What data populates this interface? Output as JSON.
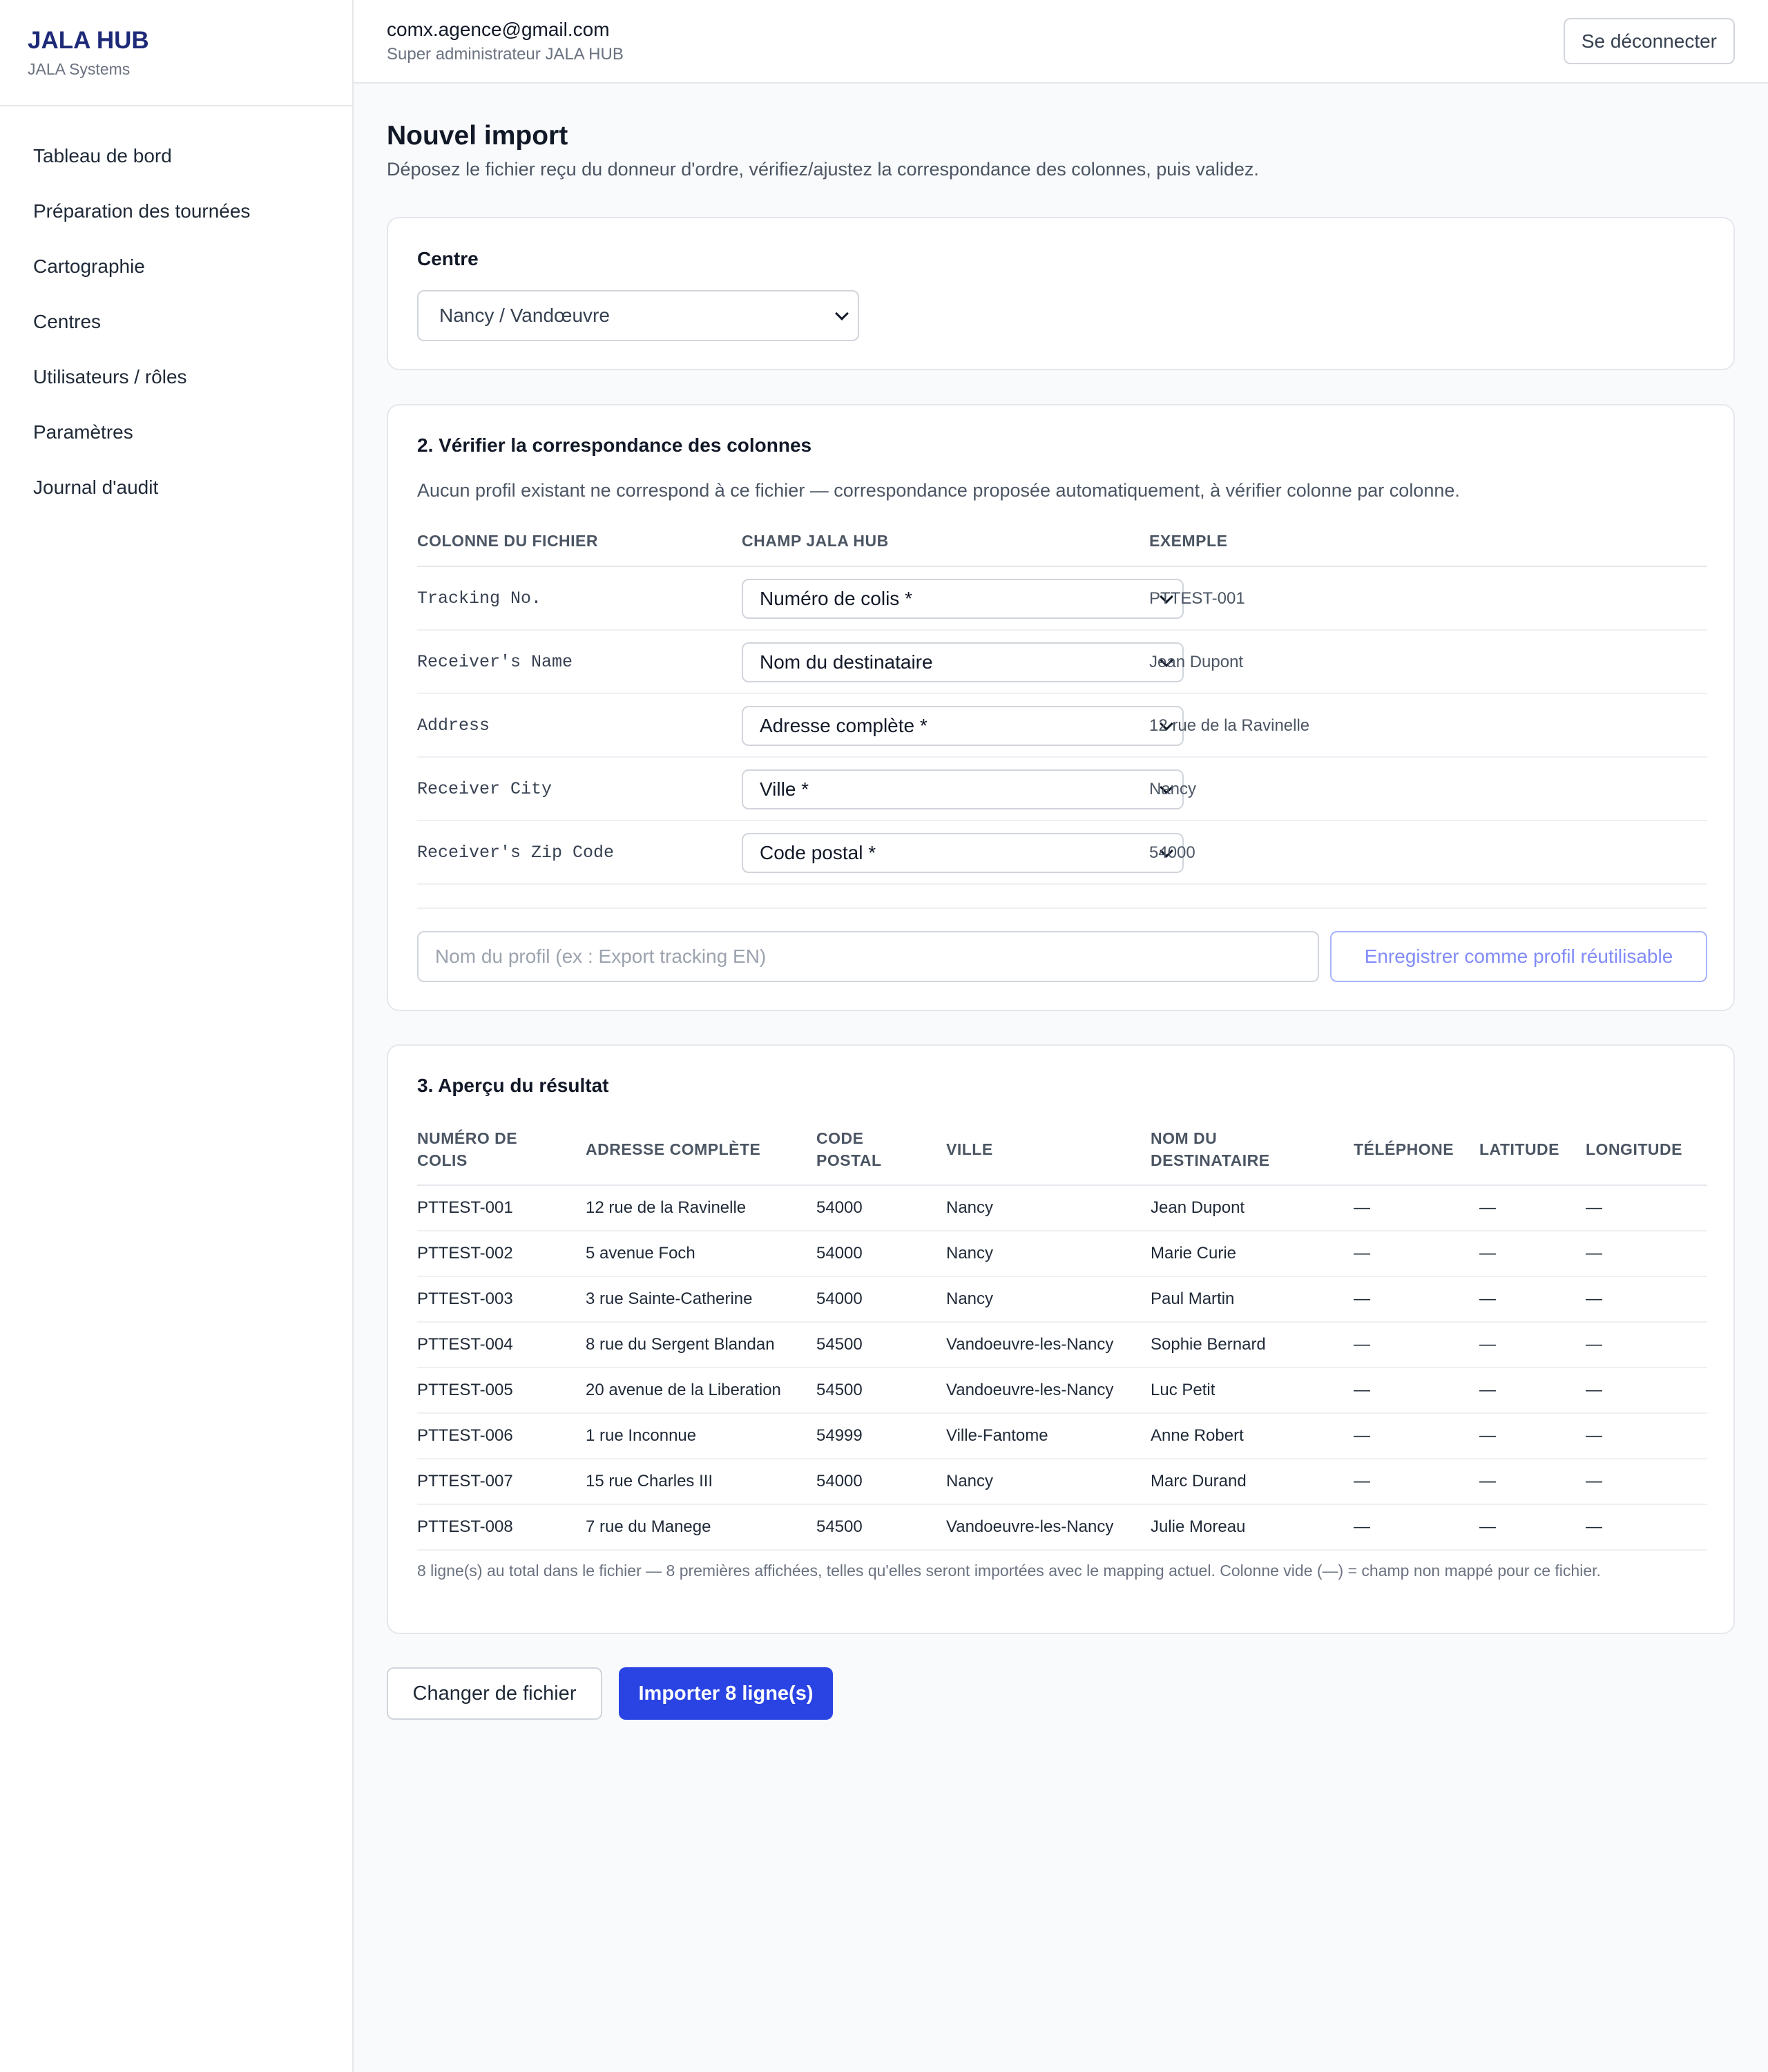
{
  "brand": {
    "title": "JALA HUB",
    "subtitle": "JALA Systems"
  },
  "sidebar": {
    "items": [
      {
        "label": "Tableau de bord"
      },
      {
        "label": "Préparation des tournées"
      },
      {
        "label": "Cartographie"
      },
      {
        "label": "Centres"
      },
      {
        "label": "Utilisateurs / rôles"
      },
      {
        "label": "Paramètres"
      },
      {
        "label": "Journal d'audit"
      }
    ]
  },
  "header": {
    "email": "comx.agence@gmail.com",
    "role": "Super administrateur JALA HUB",
    "logout_label": "Se déconnecter"
  },
  "page": {
    "title": "Nouvel import",
    "description": "Déposez le fichier reçu du donneur d'ordre, vérifiez/ajustez la correspondance des colonnes, puis validez."
  },
  "centre": {
    "label": "Centre",
    "selected": "Nancy / Vandœuvre"
  },
  "mapping": {
    "title": "2. Vérifier la correspondance des colonnes",
    "description": "Aucun profil existant ne correspond à ce fichier — correspondance proposée automatiquement, à vérifier colonne par colonne.",
    "headers": {
      "file_column": "Colonne du fichier",
      "field": "Champ JALA HUB",
      "example": "Exemple"
    },
    "rows": [
      {
        "column": "Tracking No.",
        "field": "Numéro de colis *",
        "example": "PTTEST-001"
      },
      {
        "column": "Receiver's Name",
        "field": "Nom du destinataire",
        "example": "Jean Dupont"
      },
      {
        "column": "Address",
        "field": "Adresse complète *",
        "example": "12 rue de la Ravinelle"
      },
      {
        "column": "Receiver City",
        "field": "Ville *",
        "example": "Nancy"
      },
      {
        "column": "Receiver's Zip Code",
        "field": "Code postal *",
        "example": "54000"
      }
    ],
    "profile_placeholder": "Nom du profil (ex : Export tracking EN)",
    "save_profile_label": "Enregistrer comme profil réutilisable"
  },
  "preview": {
    "title": "3. Aperçu du résultat",
    "headers": {
      "tracking_l1": "Numéro de",
      "tracking_l2": "colis",
      "address": "Adresse complète",
      "zip_l1": "Code",
      "zip_l2": "postal",
      "city": "Ville",
      "name_l1": "Nom du",
      "name_l2": "destinataire",
      "phone": "Téléphone",
      "lat": "Latitude",
      "lng": "Longitude"
    },
    "rows": [
      [
        "PTTEST-001",
        "12 rue de la Ravinelle",
        "54000",
        "Nancy",
        "Jean Dupont",
        "—",
        "—",
        "—"
      ],
      [
        "PTTEST-002",
        "5 avenue Foch",
        "54000",
        "Nancy",
        "Marie Curie",
        "—",
        "—",
        "—"
      ],
      [
        "PTTEST-003",
        "3 rue Sainte-Catherine",
        "54000",
        "Nancy",
        "Paul Martin",
        "—",
        "—",
        "—"
      ],
      [
        "PTTEST-004",
        "8 rue du Sergent Blandan",
        "54500",
        "Vandoeuvre-les-Nancy",
        "Sophie Bernard",
        "—",
        "—",
        "—"
      ],
      [
        "PTTEST-005",
        "20 avenue de la Liberation",
        "54500",
        "Vandoeuvre-les-Nancy",
        "Luc Petit",
        "—",
        "—",
        "—"
      ],
      [
        "PTTEST-006",
        "1 rue Inconnue",
        "54999",
        "Ville-Fantome",
        "Anne Robert",
        "—",
        "—",
        "—"
      ],
      [
        "PTTEST-007",
        "15 rue Charles III",
        "54000",
        "Nancy",
        "Marc Durand",
        "—",
        "—",
        "—"
      ],
      [
        "PTTEST-008",
        "7 rue du Manege",
        "54500",
        "Vandoeuvre-les-Nancy",
        "Julie Moreau",
        "—",
        "—",
        "—"
      ]
    ],
    "footnote": "8 ligne(s) au total dans le fichier — 8 premières affichées, telles qu'elles seront importées avec le mapping actuel. Colonne vide (—) = champ non mappé pour ce fichier."
  },
  "actions": {
    "change_file": "Changer de fichier",
    "import": "Importer 8 ligne(s)"
  }
}
